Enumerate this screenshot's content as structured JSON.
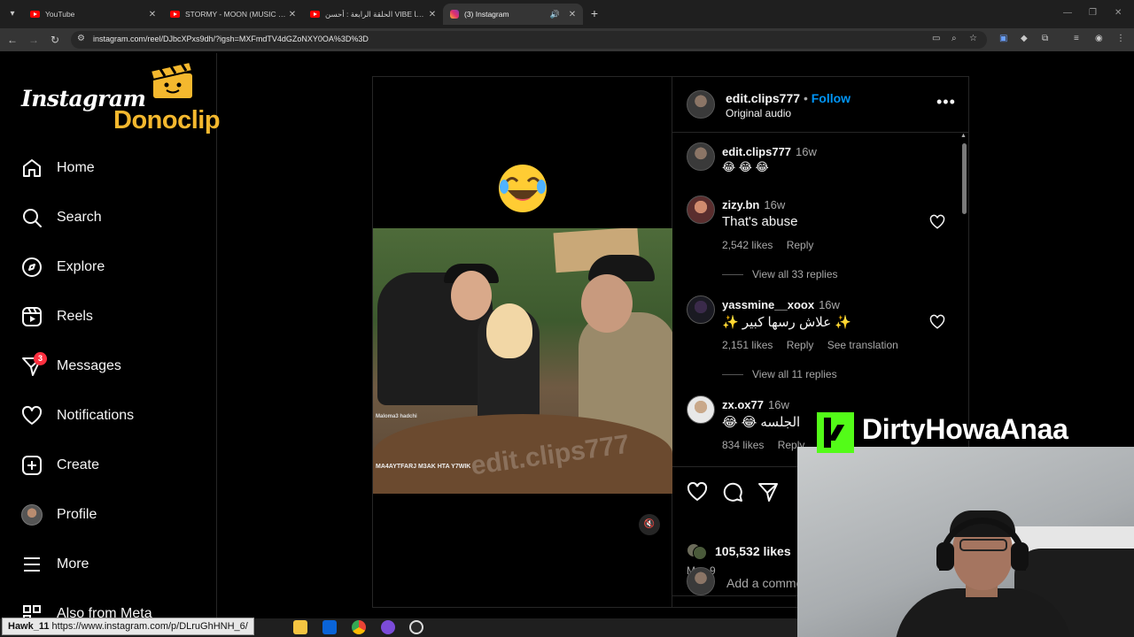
{
  "browser": {
    "tabs": [
      {
        "title": "YouTube",
        "icon": "youtube-icon",
        "active": false
      },
      {
        "title": "STORMY - MOON (MUSIC VISU",
        "icon": "youtube-icon",
        "active": false
      },
      {
        "title": "الحلقة الرابعة : أحسن VIBE مع ها",
        "icon": "youtube-icon",
        "active": false
      },
      {
        "title": "(3) Instagram",
        "icon": "instagram-icon",
        "active": true
      }
    ],
    "url": "instagram.com/reel/DJbcXPxs9dh/?igsh=MXFmdTV4dGZoNXY0OA%3D%3D",
    "status_url": "https://www.instagram.com/p/DLruGhHNH_6/",
    "taskbar_name": "Hawk_11"
  },
  "sidebar": {
    "logo": "Instagram",
    "overlay_brand": "Donoclip",
    "items": [
      {
        "label": "Home",
        "icon": "home-icon"
      },
      {
        "label": "Search",
        "icon": "search-icon"
      },
      {
        "label": "Explore",
        "icon": "compass-icon"
      },
      {
        "label": "Reels",
        "icon": "reels-icon"
      },
      {
        "label": "Messages",
        "icon": "messenger-icon",
        "badge": "3"
      },
      {
        "label": "Notifications",
        "icon": "heart-icon"
      },
      {
        "label": "Create",
        "icon": "plus-square-icon"
      },
      {
        "label": "Profile",
        "icon": "avatar"
      },
      {
        "label": "More",
        "icon": "menu-icon"
      },
      {
        "label": "Also from Meta",
        "icon": "meta-icon"
      }
    ]
  },
  "post": {
    "author": "edit.clips777",
    "separator": "•",
    "follow_label": "Follow",
    "audio": "Original audio",
    "media_emoji": "😂",
    "video_watermark": "edit.clips777",
    "video_caption": "MA4AYTFARJ M3AK HTA Y7WIK",
    "video_subtitle": "Maloma3 hadchi",
    "likes": "105,532 likes",
    "date": "May 9",
    "add_comment_placeholder": "Add a comment...",
    "caption": {
      "user": "edit.clips777",
      "time": "16w",
      "text": "😂 😂 😂"
    },
    "comments": [
      {
        "user": "zizy.bn",
        "time": "16w",
        "text": "That's abuse",
        "likes": "2,542 likes",
        "reply": "Reply",
        "view_replies": "View all 33 replies"
      },
      {
        "user": "yassmine__xoox",
        "time": "16w",
        "text": "✨ علاش رسها كبير ✨",
        "likes": "2,151 likes",
        "reply": "Reply",
        "translate": "See translation",
        "view_replies": "View all 11 replies"
      },
      {
        "user": "zx.ox77",
        "time": "16w",
        "text": "😂 😂 الجلسه",
        "likes": "834 likes",
        "reply": "Reply"
      }
    ]
  },
  "stream": {
    "platform_icon": "kick-logo",
    "channel": "DirtyHowaAnaa"
  },
  "colors": {
    "background": "#000000",
    "accent": "#0095f6",
    "badge": "#ff3040",
    "kick": "#53fc18",
    "donoclip": "#f4b82e"
  }
}
